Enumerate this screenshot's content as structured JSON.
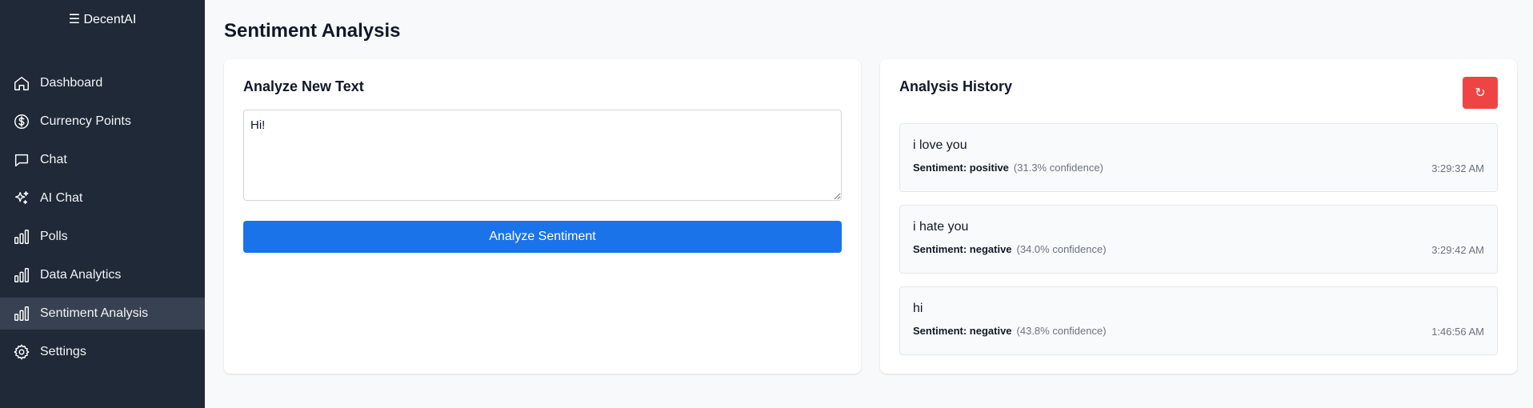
{
  "sidebar": {
    "brand": "☰ DecentAI",
    "items": [
      {
        "label": "Dashboard",
        "icon": "home-icon"
      },
      {
        "label": "Currency Points",
        "icon": "dollar-circle-icon"
      },
      {
        "label": "Chat",
        "icon": "chat-bubble-icon"
      },
      {
        "label": "AI Chat",
        "icon": "sparkles-icon"
      },
      {
        "label": "Polls",
        "icon": "bar-chart-icon"
      },
      {
        "label": "Data Analytics",
        "icon": "bar-chart-icon"
      },
      {
        "label": "Sentiment Analysis",
        "icon": "bar-chart-icon",
        "active": true
      },
      {
        "label": "Settings",
        "icon": "gear-icon"
      }
    ]
  },
  "page": {
    "title": "Sentiment Analysis"
  },
  "analyze": {
    "title": "Analyze New Text",
    "input_value": "Hi!",
    "button_label": "Analyze Sentiment"
  },
  "history": {
    "title": "Analysis History",
    "refresh_icon": "↻",
    "items": [
      {
        "text": "i love you",
        "sentiment": "Sentiment: positive",
        "confidence": "(31.3% confidence)",
        "time": "3:29:32 AM"
      },
      {
        "text": "i hate you",
        "sentiment": "Sentiment: negative",
        "confidence": "(34.0% confidence)",
        "time": "3:29:42 AM"
      },
      {
        "text": "hi",
        "sentiment": "Sentiment: negative",
        "confidence": "(43.8% confidence)",
        "time": "1:46:56 AM"
      }
    ]
  },
  "colors": {
    "sidebar_bg": "#1f2937",
    "active_item_bg": "#374151",
    "primary": "#1a73e8",
    "danger": "#ef4444"
  }
}
